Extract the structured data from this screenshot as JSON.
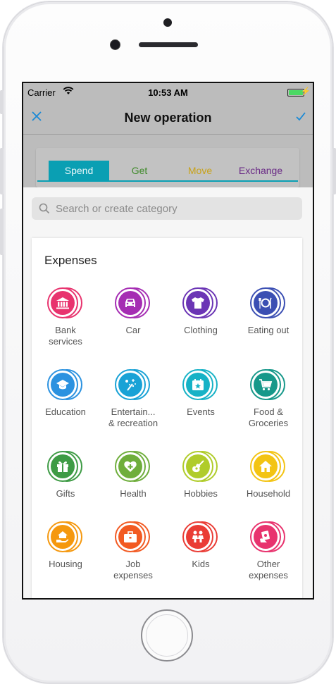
{
  "status": {
    "carrier": "Carrier",
    "time": "10:53 AM"
  },
  "nav": {
    "title": "New operation"
  },
  "tabs": [
    {
      "label": "Spend"
    },
    {
      "label": "Get"
    },
    {
      "label": "Move"
    },
    {
      "label": "Exchange"
    }
  ],
  "search": {
    "placeholder": "Search or create category"
  },
  "section": {
    "title": "Expenses"
  },
  "categories": [
    {
      "l1": "Bank",
      "l2": "services",
      "icon": "bank-icon",
      "color": "#e8336e"
    },
    {
      "l1": "Car",
      "l2": "",
      "icon": "car-icon",
      "color": "#a52db3"
    },
    {
      "l1": "Clothing",
      "l2": "",
      "icon": "tshirt-icon",
      "color": "#6b35b5"
    },
    {
      "l1": "Eating out",
      "l2": "",
      "icon": "restaurant-icon",
      "color": "#3b4fb3"
    },
    {
      "l1": "Education",
      "l2": "",
      "icon": "graduation-cap-icon",
      "color": "#2b92e0"
    },
    {
      "l1": "Entertain...",
      "l2": "& recreation",
      "icon": "fireworks-icon",
      "color": "#19a2d6"
    },
    {
      "l1": "Events",
      "l2": "",
      "icon": "calendar-star-icon",
      "color": "#16b2c6"
    },
    {
      "l1": "Food &",
      "l2": "Groceries",
      "icon": "shopping-cart-icon",
      "color": "#17988a"
    },
    {
      "l1": "Gifts",
      "l2": "",
      "icon": "gift-icon",
      "color": "#3e9b45"
    },
    {
      "l1": "Health",
      "l2": "",
      "icon": "heart-plus-icon",
      "color": "#6fae3c"
    },
    {
      "l1": "Hobbies",
      "l2": "",
      "icon": "guitar-icon",
      "color": "#b0cc2a"
    },
    {
      "l1": "Household",
      "l2": "",
      "icon": "house-icon",
      "color": "#f3c414"
    },
    {
      "l1": "Housing",
      "l2": "",
      "icon": "house-hand-icon",
      "color": "#f5980e"
    },
    {
      "l1": "Job",
      "l2": "expenses",
      "icon": "briefcase-icon",
      "color": "#f25a22"
    },
    {
      "l1": "Kids",
      "l2": "",
      "icon": "kids-icon",
      "color": "#ea3c35"
    },
    {
      "l1": "Other",
      "l2": "expenses",
      "icon": "money-hand-icon",
      "color": "#e8336e"
    }
  ]
}
